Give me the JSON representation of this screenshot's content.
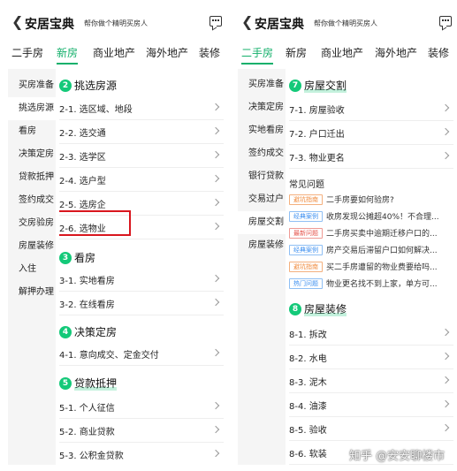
{
  "left": {
    "back_icon": "chevron-left-icon",
    "title": "安居宝典",
    "subtitle": "帮你做个精明买房人",
    "tabs": [
      "二手房",
      "新房",
      "商业地产",
      "海外地产",
      "装修"
    ],
    "active_tab": "新房",
    "sidebar": [
      "买房准备",
      "挑选房源",
      "看房",
      "决策定房",
      "贷款抵押",
      "签约成交",
      "交房验房",
      "房屋装修",
      "入住",
      "解押办理"
    ],
    "active_sidebar": "挑选房源",
    "sections": [
      {
        "num": "2",
        "title": "挑选房源",
        "items": [
          "2-1. 选区域、地段",
          "2-2. 选交通",
          "2-3. 选学区",
          "2-4. 选户型",
          "2-5. 选房企",
          "2-6. 选物业"
        ]
      },
      {
        "num": "3",
        "title": "看房",
        "items": [
          "3-1. 实地看房",
          "3-2. 在线看房"
        ]
      },
      {
        "num": "4",
        "title": "决策定房",
        "items": [
          "4-1. 意向成交、定金交付"
        ]
      },
      {
        "num": "5",
        "title": "贷款抵押",
        "items": [
          "5-1. 个人征信",
          "5-2. 商业贷款",
          "5-3. 公积金贷款"
        ]
      }
    ],
    "highlighted_item": "2-6. 选物业"
  },
  "right": {
    "back_icon": "chevron-left-icon",
    "title": "安居宝典",
    "subtitle": "帮你做个精明买房人",
    "tabs": [
      "二手房",
      "新房",
      "商业地产",
      "海外地产",
      "装修"
    ],
    "active_tab": "二手房",
    "sidebar": [
      "买房准备",
      "决策定房",
      "实地看房",
      "签约成交",
      "银行贷款",
      "交易过户",
      "房屋交割",
      "房屋装修"
    ],
    "active_sidebar": "房屋交割",
    "section7": {
      "num": "7",
      "title": "房屋交割",
      "items": [
        "7-1. 房屋验收",
        "7-2. 户口迁出",
        "7-3. 物业更名"
      ]
    },
    "faq_title": "常见问题",
    "faqs": [
      {
        "tag": "避坑指南",
        "text": "二手房要如何验房?"
      },
      {
        "tag": "经典案例",
        "text": "收房发现公摊超40%！不合理..."
      },
      {
        "tag": "最新问题",
        "text": "二手房买卖中逾期迁移户口的..."
      },
      {
        "tag": "经典案例",
        "text": "房产交易后滞留户口如何解决..."
      },
      {
        "tag": "避坑指南",
        "text": "买二手房遭留的物业费要给吗..."
      },
      {
        "tag": "热门问题",
        "text": "物业更名找不到上家，单方可..."
      }
    ],
    "section8": {
      "num": "8",
      "title": "房屋装修",
      "items": [
        "8-1. 拆改",
        "8-2. 水电",
        "8-3. 泥木",
        "8-4. 油漆",
        "8-5. 验收",
        "8-6. 软装"
      ]
    }
  },
  "watermark": "知乎 @安安聊楼市",
  "colors": {
    "accent": "#14b06b",
    "badge": "#14c979",
    "highlight": "#d9161e"
  }
}
